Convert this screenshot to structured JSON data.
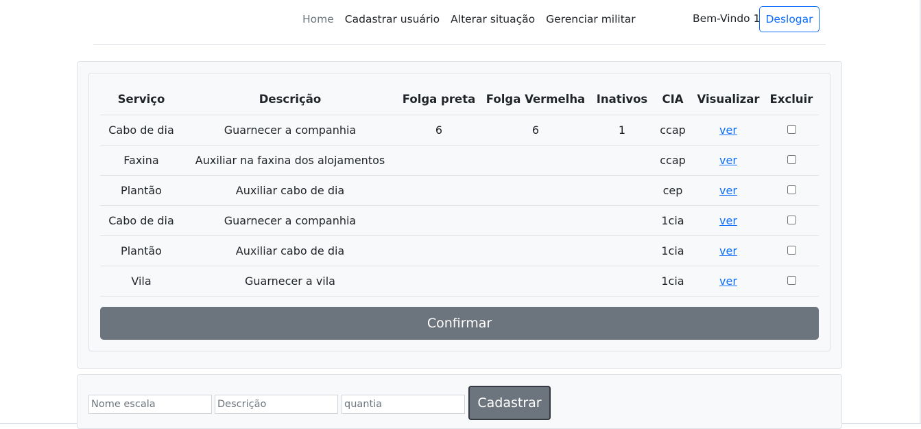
{
  "nav": {
    "items": [
      {
        "label": "Home",
        "active": true
      },
      {
        "label": "Cadastrar usuário",
        "active": false
      },
      {
        "label": "Alterar situação",
        "active": false
      },
      {
        "label": "Gerenciar militar",
        "active": false
      }
    ],
    "welcome": "Bem-Vindo 1",
    "logout_label": "Deslogar"
  },
  "table": {
    "headers": [
      "Serviço",
      "Descrição",
      "Folga preta",
      "Folga Vermelha",
      "Inativos",
      "CIA",
      "Visualizar",
      "Excluir"
    ],
    "rows": [
      {
        "servico": "Cabo de dia",
        "descricao": "Guarnecer a companhia",
        "folga_preta": "6",
        "folga_vermelha": "6",
        "inativos": "1",
        "cia": "ccap",
        "link": "ver"
      },
      {
        "servico": "Faxina",
        "descricao": "Auxiliar na faxina dos alojamentos",
        "folga_preta": "",
        "folga_vermelha": "",
        "inativos": "",
        "cia": "ccap",
        "link": "ver"
      },
      {
        "servico": "Plantão",
        "descricao": "Auxiliar cabo de dia",
        "folga_preta": "",
        "folga_vermelha": "",
        "inativos": "",
        "cia": "cep",
        "link": "ver"
      },
      {
        "servico": "Cabo de dia",
        "descricao": "Guarnecer a companhia",
        "folga_preta": "",
        "folga_vermelha": "",
        "inativos": "",
        "cia": "1cia",
        "link": "ver"
      },
      {
        "servico": "Plantão",
        "descricao": "Auxiliar cabo de dia",
        "folga_preta": "",
        "folga_vermelha": "",
        "inativos": "",
        "cia": "1cia",
        "link": "ver"
      },
      {
        "servico": "Vila",
        "descricao": "Guarnecer a vila",
        "folga_preta": "",
        "folga_vermelha": "",
        "inativos": "",
        "cia": "1cia",
        "link": "ver"
      }
    ],
    "confirm_label": "Confirmar"
  },
  "form": {
    "name_placeholder": "Nome escala",
    "desc_placeholder": "Descrição",
    "qty_placeholder": "quantia",
    "submit_label": "Cadastrar"
  },
  "colors": {
    "primary": "#0d6efd",
    "secondary": "#6c757d",
    "panel": "#f8f9fa"
  }
}
